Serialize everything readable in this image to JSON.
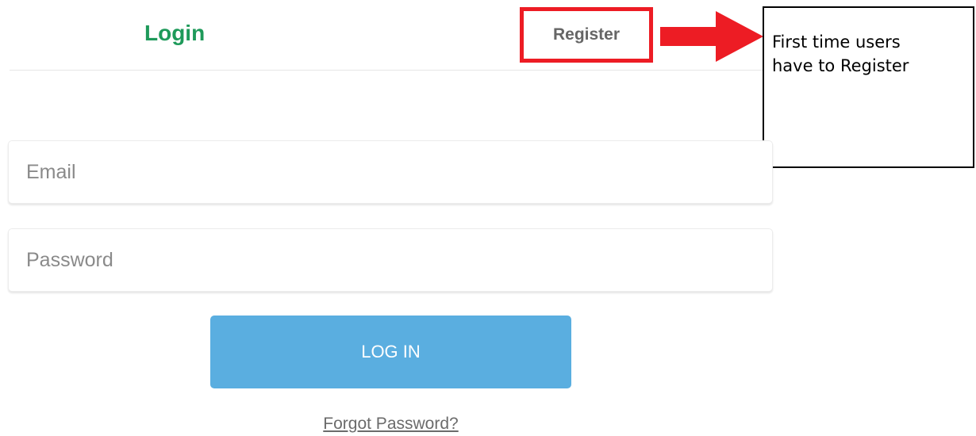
{
  "tabs": {
    "login_label": "Login",
    "register_label": "Register"
  },
  "annotation": {
    "line1": "First time users",
    "line2": "have to Register",
    "highlight_color": "#ed1c24"
  },
  "form": {
    "email_placeholder": "Email",
    "password_placeholder": "Password",
    "login_button_label": "LOG IN",
    "forgot_password_label": "Forgot Password?"
  },
  "colors": {
    "active_tab": "#1e9a5a",
    "inactive_tab": "#666666",
    "button_bg": "#5aaee0",
    "button_text": "#ffffff"
  }
}
